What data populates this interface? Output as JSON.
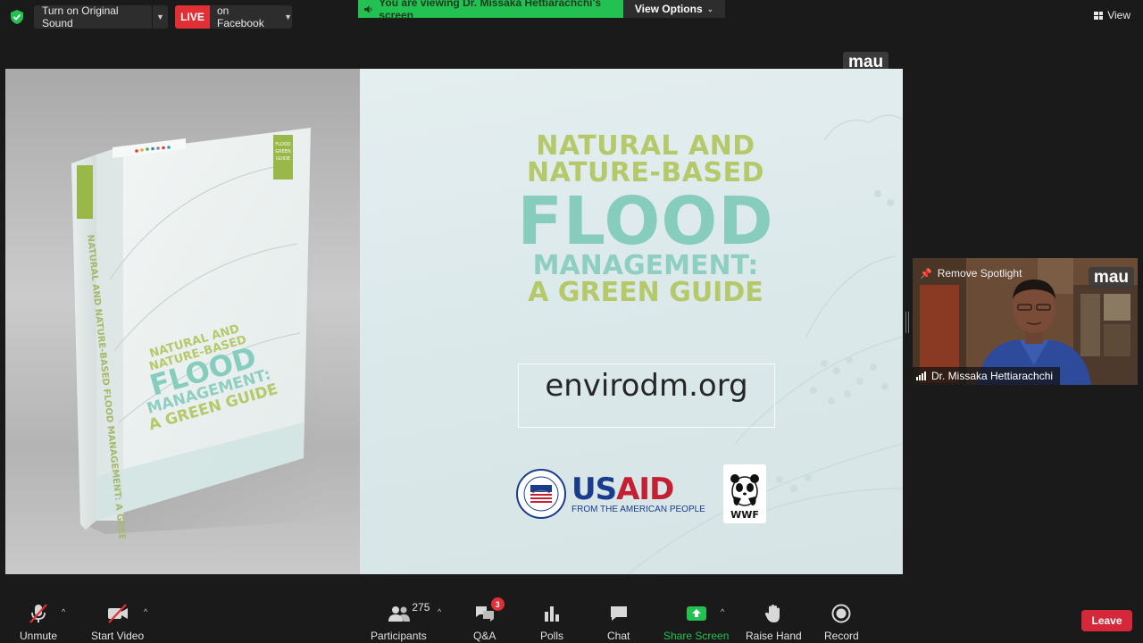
{
  "topbar": {
    "original_sound_label": "Turn on Original Sound",
    "live_badge": "LIVE",
    "live_destination": "on Facebook",
    "viewing_banner": "You are viewing Dr. Missaka Hettiarachchi's screen",
    "view_options_label": "View Options",
    "view_label": "View"
  },
  "share": {
    "watermark": "mau",
    "slide": {
      "title_line1": "NATURAL AND",
      "title_line2": "NATURE-BASED",
      "title_line3": "FLOOD",
      "title_line4": "MANAGEMENT:",
      "title_line5": "A GREEN GUIDE",
      "url": "envirodm.org",
      "usaid_us": "US",
      "usaid_aid": "AID",
      "usaid_tagline": "FROM THE AMERICAN PEOPLE",
      "wwf_label": "WWF",
      "book_spine_title": "NATURAL AND NATURE-BASED FLOOD MANAGEMENT: A GREEN GUIDE",
      "book_cover_line1": "NATURAL AND",
      "book_cover_line2": "NATURE-BASED",
      "book_cover_line3": "FLOOD",
      "book_cover_line4": "MANAGEMENT:",
      "book_cover_line5": "A GREEN GUIDE",
      "book_tab": "FLOOD GREEN GUIDE"
    }
  },
  "speaker": {
    "remove_spotlight_label": "Remove Spotlight",
    "watermark": "mau",
    "name": "Dr. Missaka Hettiarachchi"
  },
  "toolbar": {
    "unmute": "Unmute",
    "start_video": "Start Video",
    "participants": "Participants",
    "participants_count": "275",
    "qa": "Q&A",
    "qa_badge": "3",
    "polls": "Polls",
    "chat": "Chat",
    "share_screen": "Share Screen",
    "raise_hand": "Raise Hand",
    "record": "Record",
    "leave": "Leave"
  },
  "colors": {
    "live_red": "#e02f35",
    "share_green": "#23c152",
    "leave_red": "#d5283a",
    "title_green": "#b6c96a",
    "title_teal": "#86cdbd",
    "usaid_blue": "#1a3c8c",
    "usaid_red": "#c42033"
  }
}
